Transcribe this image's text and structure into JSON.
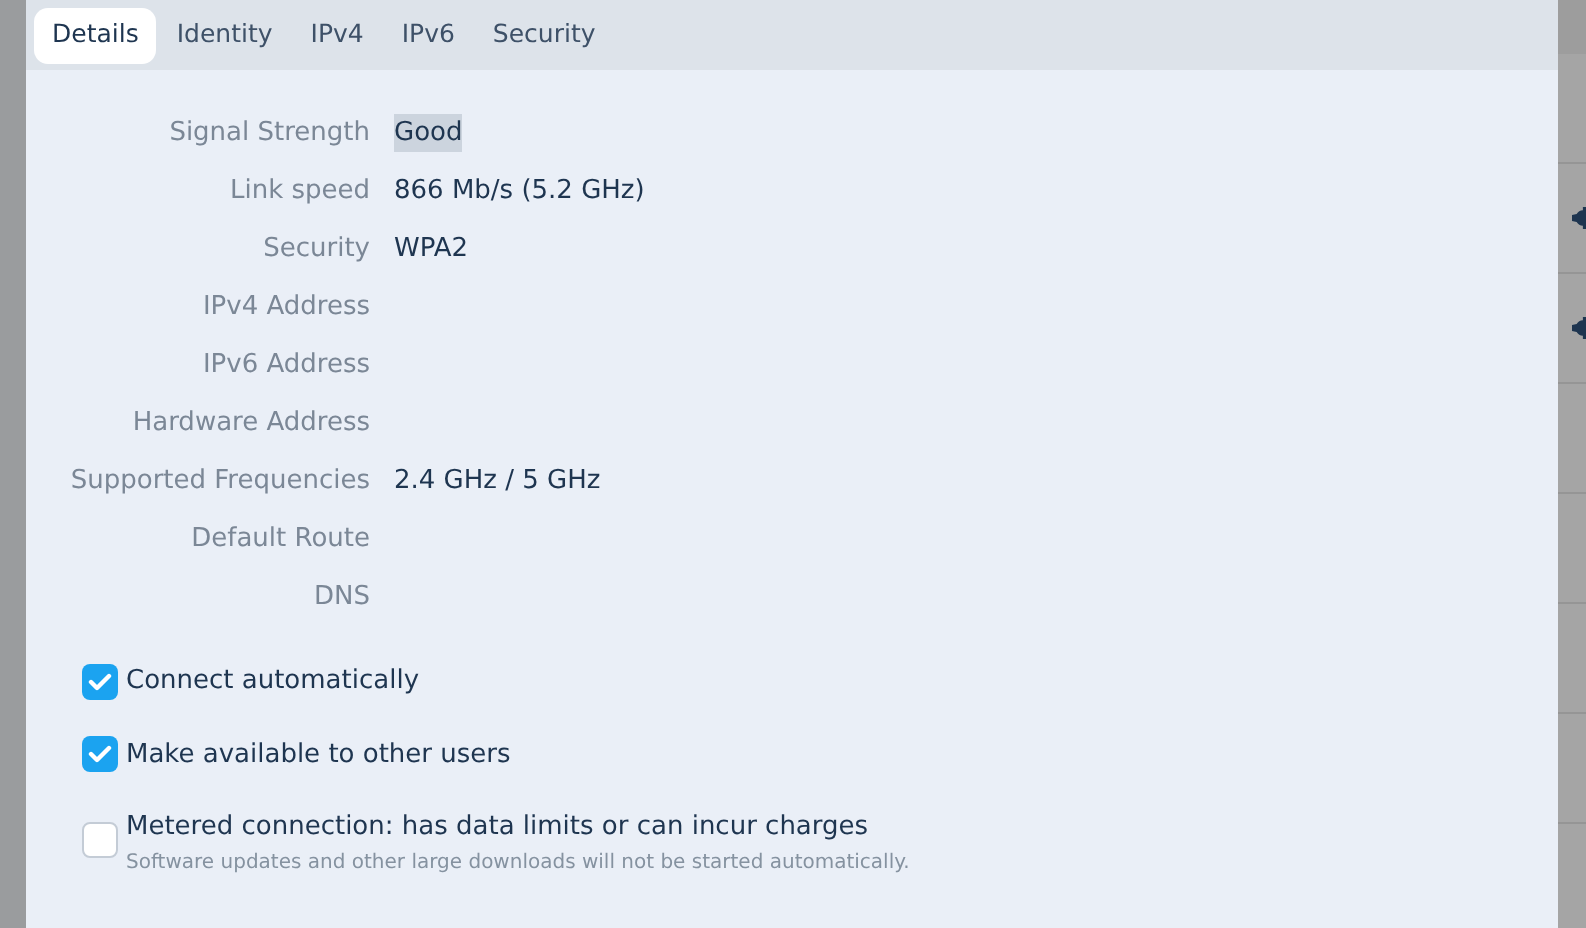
{
  "tabs": [
    {
      "label": "Details",
      "selected": true
    },
    {
      "label": "Identity",
      "selected": false
    },
    {
      "label": "IPv4",
      "selected": false
    },
    {
      "label": "IPv6",
      "selected": false
    },
    {
      "label": "Security",
      "selected": false
    }
  ],
  "details": [
    {
      "label": "Signal Strength",
      "value": "Good",
      "highlighted": true
    },
    {
      "label": "Link speed",
      "value": "866 Mb/s (5.2 GHz)",
      "highlighted": false
    },
    {
      "label": "Security",
      "value": "WPA2",
      "highlighted": false
    },
    {
      "label": "IPv4 Address"
    },
    {
      "label": "IPv6 Address"
    },
    {
      "label": "Hardware Address"
    },
    {
      "label": "Supported Frequencies",
      "value": "2.4 GHz / 5 GHz",
      "highlighted": false
    },
    {
      "label": "Default Route"
    },
    {
      "label": "DNS"
    }
  ],
  "options": [
    {
      "label": "Connect automatically",
      "checked": true
    },
    {
      "label": "Make available to other users",
      "checked": true
    },
    {
      "label": "Metered connection: has data limits or can incur charges",
      "hint": "Software updates and other large downloads will not be started automatically.",
      "checked": false
    }
  ],
  "background_rows": [
    {
      "has_gear": false
    },
    {
      "has_gear": true
    },
    {
      "has_gear": true
    },
    {
      "has_gear": false
    },
    {
      "has_gear": false
    },
    {
      "has_gear": false
    },
    {
      "has_gear": false
    }
  ]
}
